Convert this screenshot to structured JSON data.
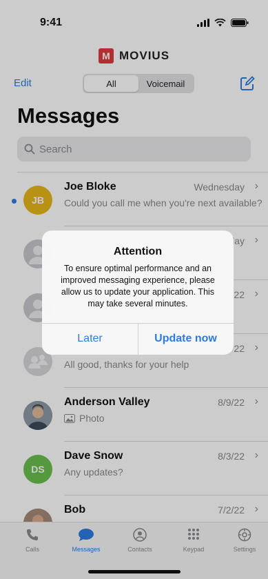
{
  "status_bar": {
    "time": "9:41"
  },
  "brand": {
    "logo_letter": "M",
    "name": "MOVIUS"
  },
  "header": {
    "edit_label": "Edit",
    "segments": [
      {
        "label": "All",
        "active": true
      },
      {
        "label": "Voicemail",
        "active": false
      }
    ],
    "compose_icon": "compose-icon"
  },
  "page_title": "Messages",
  "search": {
    "placeholder": "Search"
  },
  "conversations": [
    {
      "name": "Joe Bloke",
      "date": "Wednesday",
      "preview": "Could you call me when you're next available?",
      "avatar_initials": "JB",
      "avatar_color": "#e7b71a",
      "unread": true
    },
    {
      "name": "",
      "date": "day",
      "preview": "",
      "avatar_type": "person-placeholder"
    },
    {
      "name": "",
      "date": "22",
      "preview": "",
      "avatar_type": "person-placeholder"
    },
    {
      "name": "",
      "date": "22",
      "preview": "All good, thanks for your help",
      "avatar_type": "group-placeholder"
    },
    {
      "name": "Anderson Valley",
      "date": "8/9/22",
      "preview": "Photo",
      "avatar_type": "photo",
      "preview_icon": "photo-icon"
    },
    {
      "name": "Dave Snow",
      "date": "8/3/22",
      "preview": "Any updates?",
      "avatar_initials": "DS",
      "avatar_color": "#6bbf4e"
    },
    {
      "name": "Bob",
      "date": "7/2/22",
      "preview": "",
      "avatar_type": "photo"
    }
  ],
  "tabbar": {
    "tabs": [
      {
        "label": "Calls",
        "icon": "phone-icon",
        "active": false
      },
      {
        "label": "Messages",
        "icon": "chat-bubble-icon",
        "active": true
      },
      {
        "label": "Contacts",
        "icon": "contact-icon",
        "active": false
      },
      {
        "label": "Keypad",
        "icon": "keypad-icon",
        "active": false
      },
      {
        "label": "Settings",
        "icon": "gear-icon",
        "active": false
      }
    ]
  },
  "alert": {
    "title": "Attention",
    "message": "To ensure optimal performance and an improved messaging experience, please allow us to update your application. This may take several minutes.",
    "cancel_label": "Later",
    "confirm_label": "Update now"
  },
  "colors": {
    "accent": "#2d7be0",
    "brand": "#e03a3e"
  }
}
